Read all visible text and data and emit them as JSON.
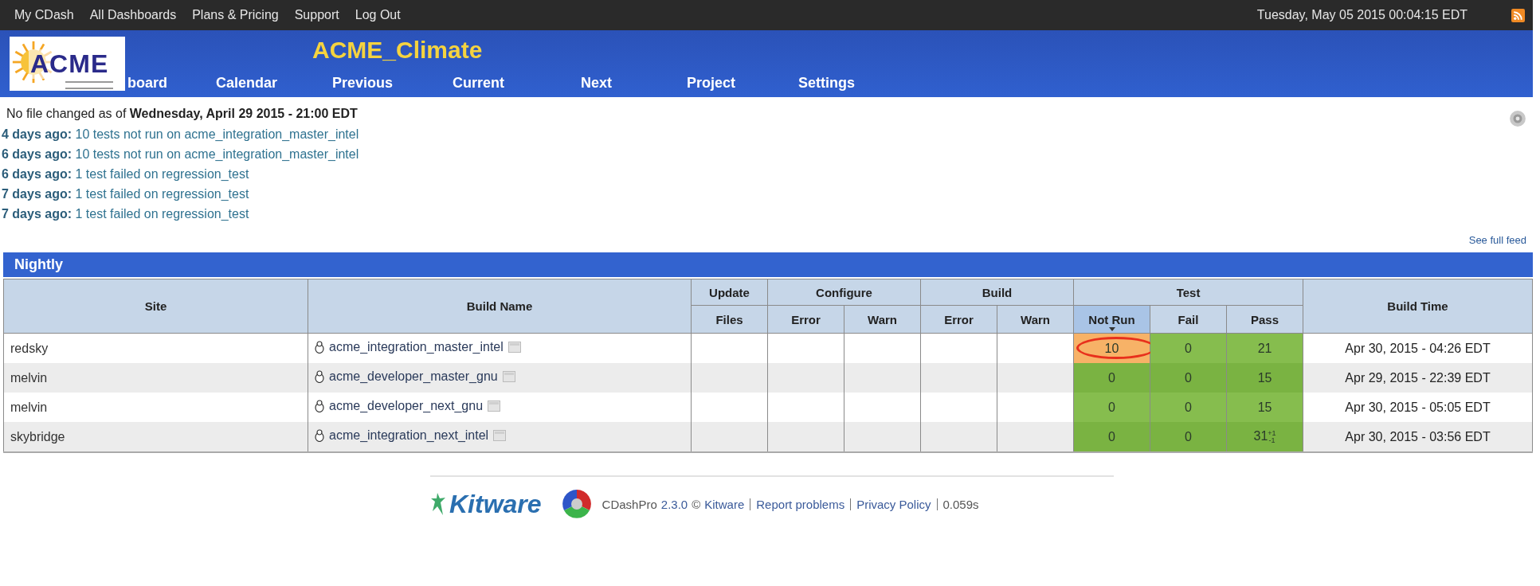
{
  "top_bar": {
    "menu": [
      "My CDash",
      "All Dashboards",
      "Plans & Pricing",
      "Support",
      "Log Out"
    ],
    "datetime": "Tuesday, May 05 2015 00:04:15 EDT"
  },
  "header": {
    "logo_text": "ACME",
    "title": "ACME_Climate",
    "nav": [
      "board",
      "Calendar",
      "Previous",
      "Current",
      "Next",
      "Project",
      "Settings"
    ]
  },
  "summary": {
    "prefix": "No file changed as of ",
    "date": "Wednesday, April 29 2015 - 21:00 EDT"
  },
  "feed": [
    {
      "when": "4 days ago:",
      "text": "10 tests not run on acme_integration_master_intel"
    },
    {
      "when": "6 days ago:",
      "text": "10 tests not run on acme_integration_master_intel"
    },
    {
      "when": "6 days ago:",
      "text": "1 test failed on regression_test"
    },
    {
      "when": "7 days ago:",
      "text": "1 test failed on regression_test"
    },
    {
      "when": "7 days ago:",
      "text": "1 test failed on regression_test"
    }
  ],
  "see_full_feed": "See full feed",
  "group": {
    "title": "Nightly",
    "site_heading": "Site",
    "build_name_heading": "Build Name",
    "build_time_heading": "Build Time",
    "header_groups": [
      {
        "label": "Update",
        "columns": [
          {
            "label": "Files",
            "sorted": false
          }
        ]
      },
      {
        "label": "Configure",
        "columns": [
          {
            "label": "Error",
            "sorted": false
          },
          {
            "label": "Warn",
            "sorted": false
          }
        ]
      },
      {
        "label": "Build",
        "columns": [
          {
            "label": "Error",
            "sorted": false
          },
          {
            "label": "Warn",
            "sorted": false
          }
        ]
      },
      {
        "label": "Test",
        "columns": [
          {
            "label": "Not Run",
            "sorted": true
          },
          {
            "label": "Fail",
            "sorted": false
          },
          {
            "label": "Pass",
            "sorted": false
          }
        ]
      }
    ],
    "rows": [
      {
        "site": "redsky",
        "build_name": "acme_integration_master_intel",
        "not_run": {
          "value": "10",
          "color": "#f7b267",
          "circled": true
        },
        "fail": {
          "value": "0",
          "color": "#86bd4e"
        },
        "pass": {
          "value": "21",
          "color": "#86bd4e"
        },
        "build_time": "Apr 30, 2015 - 04:26 EDT"
      },
      {
        "site": "melvin",
        "build_name": "acme_developer_master_gnu",
        "not_run": {
          "value": "0",
          "color": "#7ab342",
          "circled": false
        },
        "fail": {
          "value": "0",
          "color": "#7ab342"
        },
        "pass": {
          "value": "15",
          "color": "#7ab342"
        },
        "build_time": "Apr 29, 2015 - 22:39 EDT"
      },
      {
        "site": "melvin",
        "build_name": "acme_developer_next_gnu",
        "not_run": {
          "value": "0",
          "color": "#86bd4e",
          "circled": false
        },
        "fail": {
          "value": "0",
          "color": "#86bd4e"
        },
        "pass": {
          "value": "15",
          "color": "#86bd4e"
        },
        "build_time": "Apr 30, 2015 - 05:05 EDT"
      },
      {
        "site": "skybridge",
        "build_name": "acme_integration_next_intel",
        "not_run": {
          "value": "0",
          "color": "#7ab342",
          "circled": false
        },
        "fail": {
          "value": "0",
          "color": "#7ab342"
        },
        "pass": {
          "value": "31",
          "color": "#7ab342",
          "delta_up": "+1",
          "delta_down": "-1"
        },
        "build_time": "Apr 30, 2015 - 03:56 EDT"
      }
    ]
  },
  "footer": {
    "kitware_logo_text": "Kitware",
    "product": "CDashPro",
    "version": "2.3.0",
    "copyright": "©",
    "links": [
      "Kitware",
      "Report problems",
      "Privacy Policy"
    ],
    "timing": "0.059s"
  }
}
